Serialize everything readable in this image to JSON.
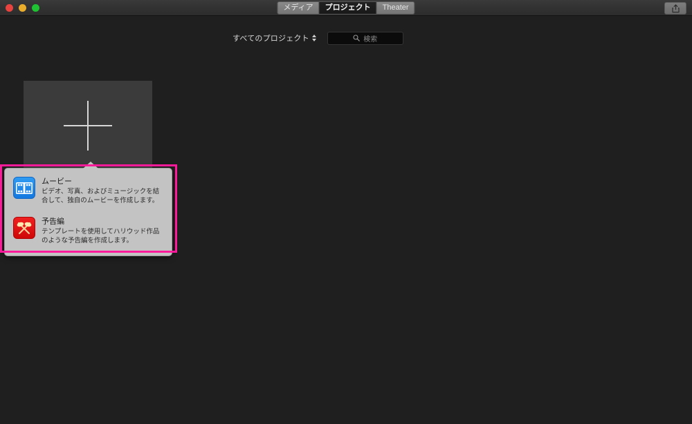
{
  "window": {
    "traffic_lights": [
      {
        "name": "close",
        "color": "#e8433f"
      },
      {
        "name": "minimize",
        "color": "#e9ad2b"
      },
      {
        "name": "maximize",
        "color": "#1fc232"
      }
    ]
  },
  "toolbar": {
    "segments": [
      {
        "label": "メディア",
        "selected": false
      },
      {
        "label": "プロジェクト",
        "selected": true
      },
      {
        "label": "Theater",
        "selected": false
      }
    ],
    "share_icon": "share-icon"
  },
  "filter": {
    "label": "すべてのプロジェクト",
    "stepper_icon": "stepper-updown-icon"
  },
  "search": {
    "icon": "search-icon",
    "placeholder": "検索",
    "value": ""
  },
  "library": {
    "new_project_tile": {
      "name": "new-project-tile",
      "icon": "plus-icon"
    }
  },
  "popover": {
    "items": [
      {
        "icon": "film-strip-icon",
        "icon_color": "#1478e0",
        "title": "ムービー",
        "description": "ビデオ、写真、およびミュージックを結合して、独自のムービーを作成します。"
      },
      {
        "icon": "searchlights-icon",
        "icon_color": "#cf0707",
        "title": "予告編",
        "description": "テンプレートを使用してハリウッド作品のような予告編を作成します。"
      }
    ]
  },
  "highlight": {
    "color": "#ff1a9b"
  }
}
